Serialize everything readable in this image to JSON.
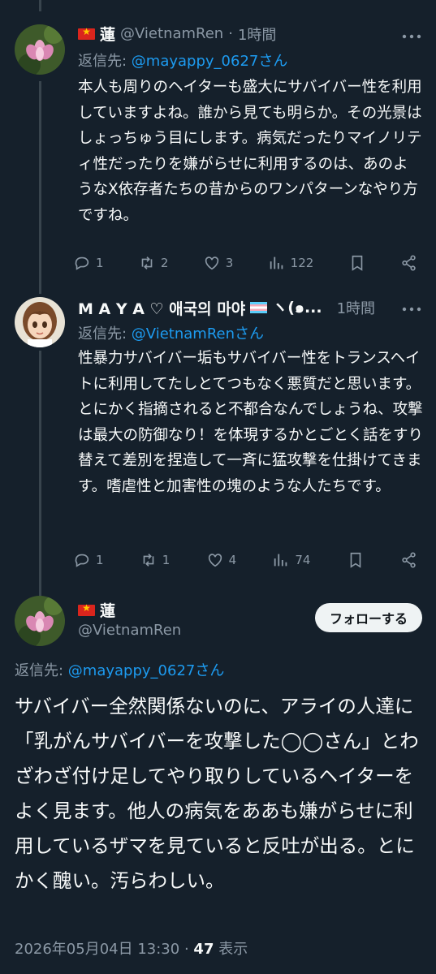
{
  "tweets": [
    {
      "name": "蓮",
      "handle": "@VietnamRen",
      "separator": "·",
      "time": "1時間",
      "reply_prefix": "返信先: ",
      "reply_to": "@mayappy_0627さん",
      "text": "本人も周りのヘイターも盛大にサバイバー性を利用していますよね。誰から見ても明らか。その光景はしょっちゅう目にします。病気だったりマイノリティ性だったりを嫌がらせに利用するのは、あのようなX依存者たちの昔からのワンパターンなやり方ですね。",
      "stats": {
        "replies": "1",
        "retweets": "2",
        "likes": "3",
        "views": "122"
      }
    },
    {
      "name": "M A Y A ♡ 애국의 마야",
      "name_tail": "ヽ(๑...",
      "handle": "",
      "separator": "",
      "time": "1時間",
      "reply_prefix": "返信先: ",
      "reply_to": "@VietnamRenさん",
      "text": "性暴力サバイバー垢もサバイバー性をトランスヘイトに利用してたしとてつもなく悪質だと思います。とにかく指摘されると不都合なんでしょうね、攻撃は最大の防御なり！を体現するかとごとく話をすり替えて差別を捏造して一斉に猛攻撃を仕掛けてきます。嗜虐性と加害性の塊のような人たちです。",
      "stats": {
        "replies": "1",
        "retweets": "1",
        "likes": "4",
        "views": "74"
      }
    }
  ],
  "main": {
    "name": "蓮",
    "handle": "@VietnamRen",
    "follow_label": "フォローする",
    "reply_prefix": "返信先: ",
    "reply_to": "@mayappy_0627さん",
    "text": "サバイバー全然関係ないのに、アライの人達に「乳がんサバイバーを攻撃した◯◯さん」とわざわざ付け足してやり取りしているヘイターをよく見ます。他人の病気をああも嫌がらせに利用しているザマを見ていると反吐が出る。とにかく醜い。汚らわしい。",
    "timestamp": "2026年05月04日 13:30",
    "separator": "·",
    "view_count": "47",
    "view_label": "表示"
  },
  "colors": {
    "background": "#15202b",
    "text": "#f7f9f9",
    "muted": "#8b98a5",
    "link": "#1d9bf0"
  },
  "icons": [
    "reply-icon",
    "retweet-icon",
    "like-icon",
    "views-icon",
    "bookmark-icon",
    "share-icon",
    "more-icon"
  ]
}
